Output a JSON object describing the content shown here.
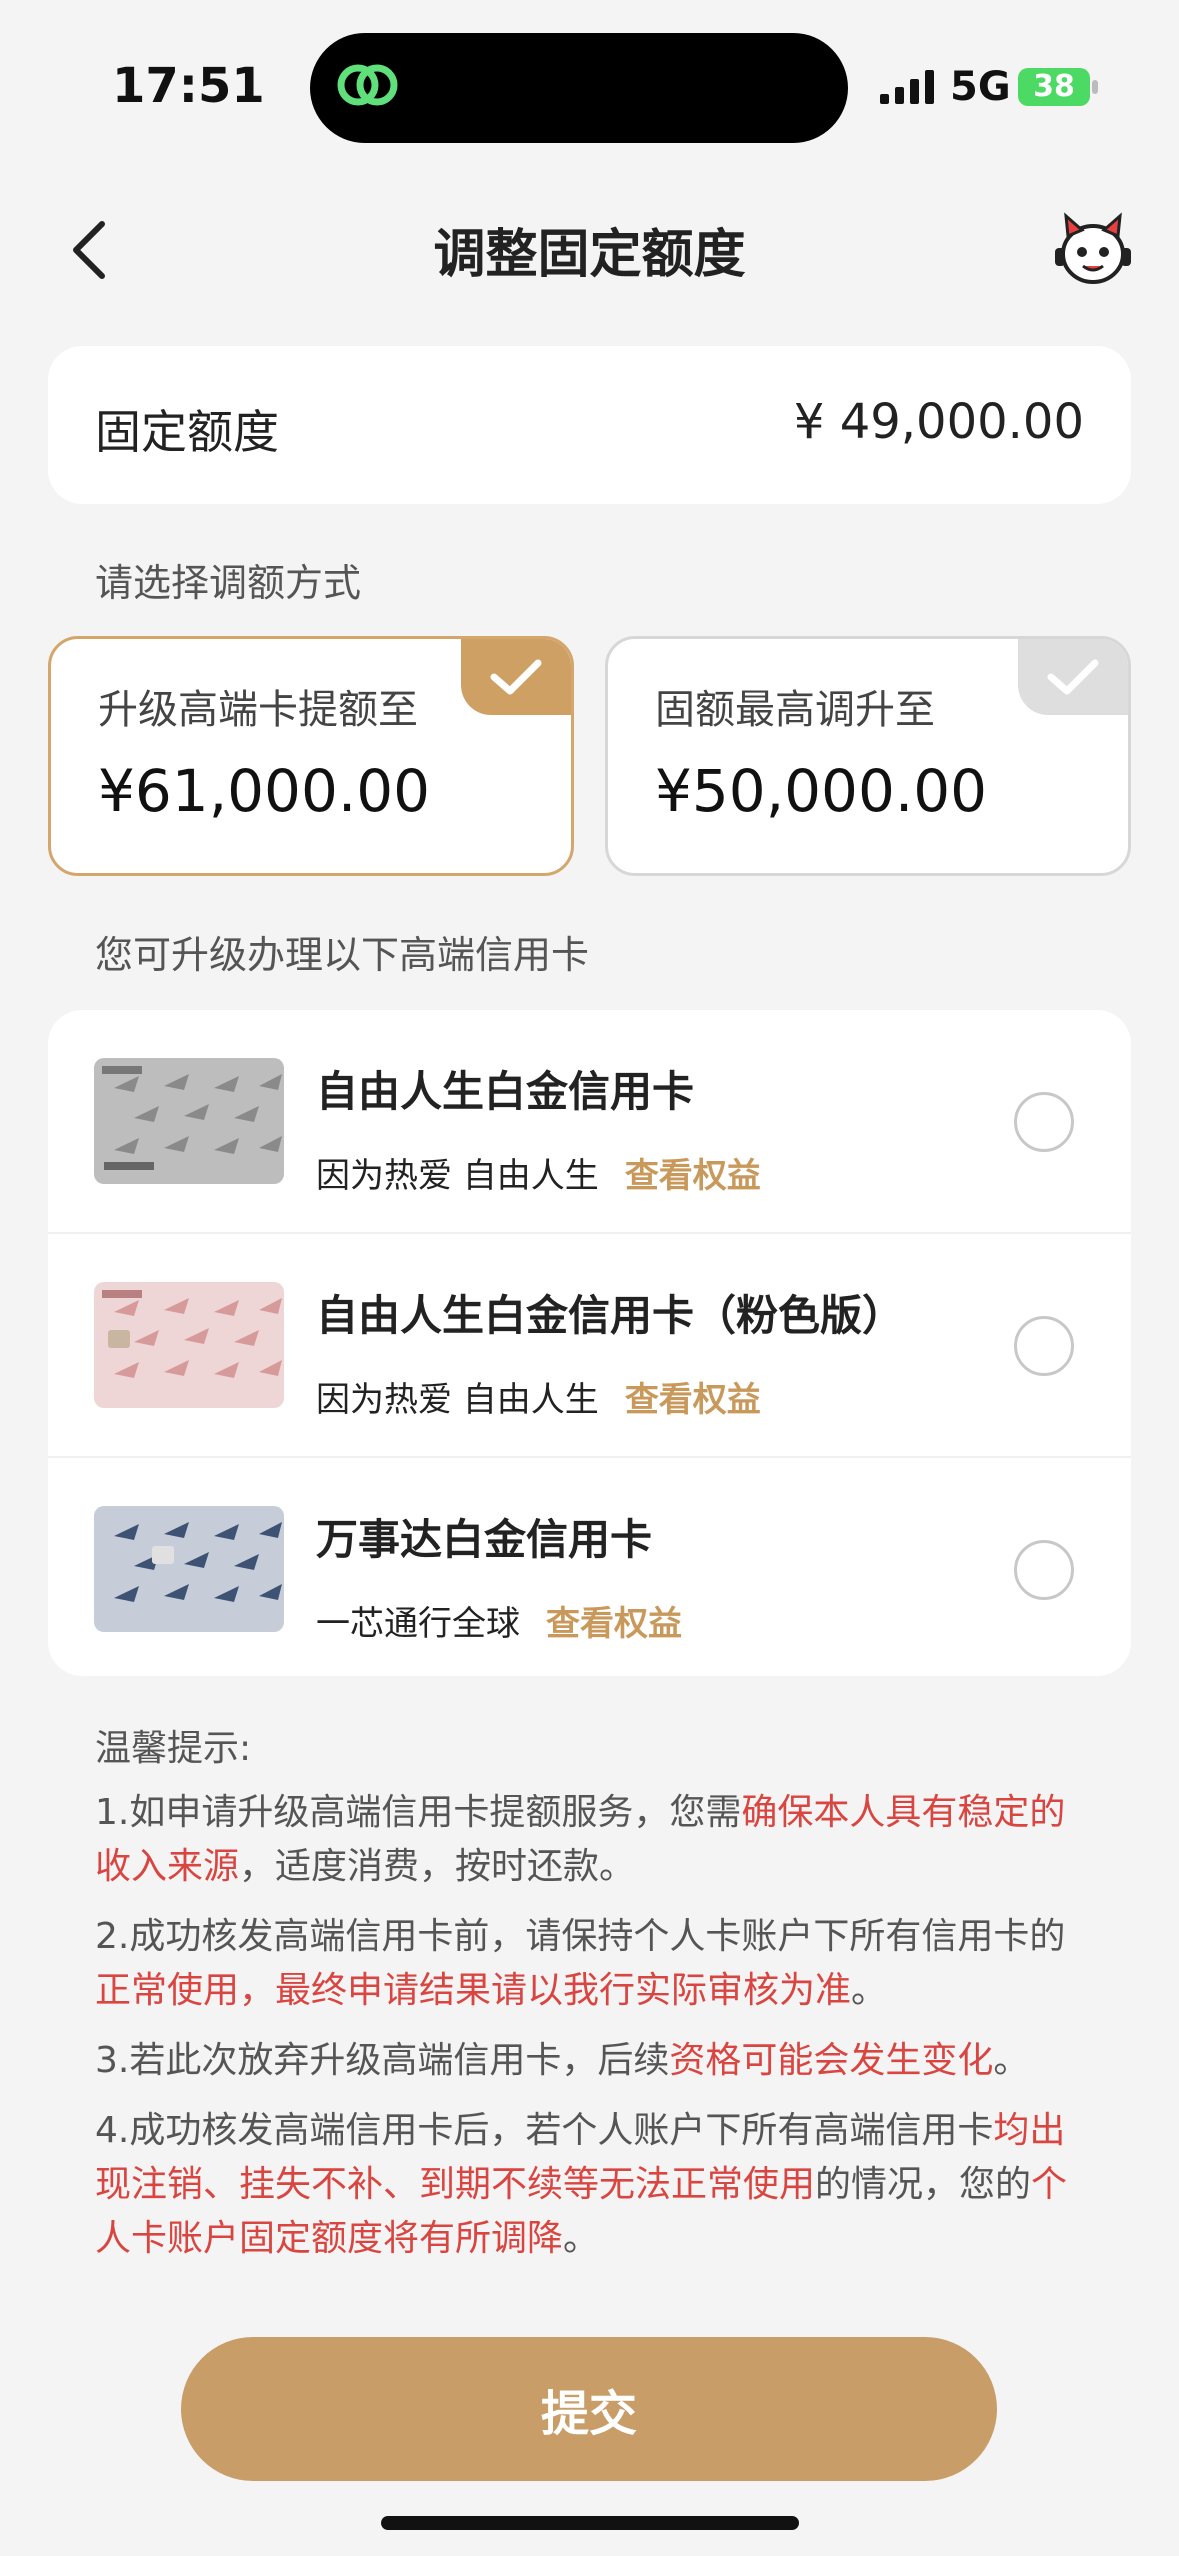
{
  "status_bar": {
    "time": "17:51",
    "network": "5G",
    "battery": "38"
  },
  "nav": {
    "title": "调整固定额度"
  },
  "limit": {
    "label": "固定额度",
    "value": "¥ 49,000.00"
  },
  "method_section": {
    "label": "请选择调额方式"
  },
  "options": [
    {
      "label": "升级高端卡提额至",
      "value": "¥61,000.00",
      "selected": true
    },
    {
      "label": "固额最高调升至",
      "value": "¥50,000.00",
      "selected": false
    }
  ],
  "cards_section": {
    "label": "您可升级办理以下高端信用卡"
  },
  "cards": [
    {
      "name": "自由人生白金信用卡",
      "desc": "因为热爱 自由人生",
      "link": "查看权益",
      "theme": "silver"
    },
    {
      "name": "自由人生白金信用卡（粉色版）",
      "desc": "因为热爱 自由人生",
      "link": "查看权益",
      "theme": "pink"
    },
    {
      "name": "万事达白金信用卡",
      "desc": "一芯通行全球",
      "link": "查看权益",
      "theme": "blue"
    }
  ],
  "tips": {
    "title": "温馨提示:",
    "items": [
      {
        "a": "1.如申请升级高端信用卡提额服务，您需",
        "b": "确保本人具有稳定的收入来源",
        "c": "，适度消费，按时还款。",
        "d": "",
        "e": ""
      },
      {
        "a": "2.成功核发高端信用卡前，请保持个人卡账户下所有信用卡的",
        "b": "正常使用，最终申请结果请以我行实际审核为准",
        "c": "。",
        "d": "",
        "e": ""
      },
      {
        "a": "3.若此次放弃升级高端信用卡，后续",
        "b": "资格可能会发生变化",
        "c": "。",
        "d": "",
        "e": ""
      },
      {
        "a": "4.成功核发高端信用卡后，若个人账户下所有高端信用卡",
        "b": "均出现注销、挂失不补、到期不续等无法正常使用",
        "c": "的情况，您的",
        "d": "个人卡账户固定额度将有所调降",
        "e": "。"
      }
    ]
  },
  "submit": {
    "label": "提交"
  },
  "colors": {
    "accent": "#c99d68",
    "link": "#c9995c",
    "warning": "#d94540"
  }
}
